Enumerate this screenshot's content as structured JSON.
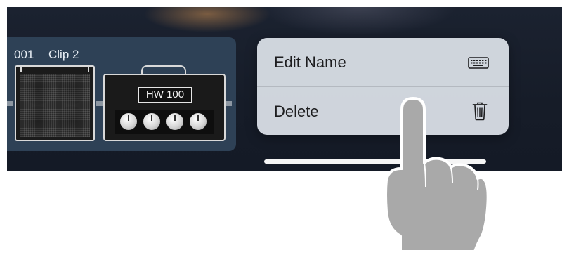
{
  "clip": {
    "number": "001",
    "name": "Clip 2",
    "amp_model": "HW 100"
  },
  "context_menu": {
    "items": [
      {
        "label": "Edit Name",
        "icon": "keyboard-icon"
      },
      {
        "label": "Delete",
        "icon": "trash-icon"
      }
    ]
  },
  "colors": {
    "background": "#161c28",
    "clip_card": "#2e4156",
    "menu": "#d6dbe2",
    "menu_text": "#1d1d1f",
    "finger": "#a8a8a8"
  }
}
